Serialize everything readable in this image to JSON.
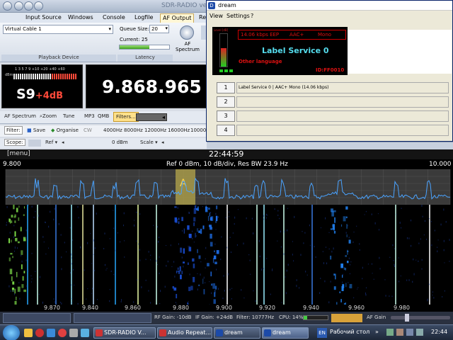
{
  "sdr": {
    "title": "SDR-RADIO ver",
    "tabs": [
      "Input Source",
      "Windows",
      "Console",
      "Logfile",
      "AF Output",
      "Re"
    ],
    "playback_device": {
      "value": "Virtual Cable 1",
      "label": "Playback Device"
    },
    "latency": {
      "queue_label": "Queue Size:",
      "queue_value": "20",
      "current_label": "Current: 25",
      "label": "Latency"
    },
    "af_spectrum_label": "AF\nSpectrum",
    "smeter": {
      "reading": "S9",
      "over": "+4dB",
      "scale_top": "1 3 5 7 9 +10 +20 +40 +60",
      "unit": "dBm"
    },
    "frequency": "9.868.965",
    "toolbar1": [
      "AF Spectrum",
      "Zoom",
      "Tune",
      "MP3",
      "QMB",
      "Filters..."
    ],
    "toolbar2": {
      "label": "Filter:",
      "items": [
        "Save",
        "Organise",
        "CW",
        "4000Hz",
        "8000Hz",
        "12000Hz",
        "16000Hz",
        "10000Hz"
      ]
    },
    "toolbar3": {
      "label": "Scope:",
      "items": [
        "Ref",
        "0 dBm",
        "Scale"
      ]
    }
  },
  "dream": {
    "title": "dream",
    "menu": [
      "View",
      "Settings",
      "?"
    ],
    "level_label": "Level [dB]",
    "status": {
      "rate": "14.06 kbps EEP",
      "codec": "AAC+",
      "mode": "Mono"
    },
    "service_label": "Label Service 0",
    "language": "Other language",
    "id": "ID:FF0010",
    "services": [
      {
        "num": "1",
        "text": "Label Service 0  |  AAC+ Mono (14.06 kbps)"
      },
      {
        "num": "2",
        "text": ""
      },
      {
        "num": "3",
        "text": ""
      },
      {
        "num": "4",
        "text": ""
      }
    ]
  },
  "spectrum": {
    "menu": "[menu]",
    "time": "22:44:59",
    "start": "9.800",
    "end": "10.000",
    "info": "Ref 0 dBm,  10 dB/div,  Res BW 23.9 Hz",
    "marker": "A",
    "axis_ticks": [
      "9.870",
      "9.880",
      "9.900",
      "9.920",
      "9.940",
      "9.960",
      "9.980"
    ],
    "axis_ticks_left": [
      "9.840",
      "9.860"
    ]
  },
  "dock": {
    "items": [
      "RF Gain: -10dB",
      "IF Gain: +24dB",
      "Filter: 10777Hz",
      "CPU: 14%",
      "AF Gain"
    ]
  },
  "taskbar": {
    "tasks": [
      "SDR-RADIO V...",
      "Audio Repeat...",
      "dream",
      "dream"
    ],
    "lang": "EN",
    "desktop": "Рабочий стол",
    "clock": "22:44"
  },
  "colors": {
    "freq_bg": "#000000",
    "dream_display_text": "#cc0000",
    "dream_service_text": "#55ddee",
    "spectrum_trace": "#4aa3ff"
  }
}
